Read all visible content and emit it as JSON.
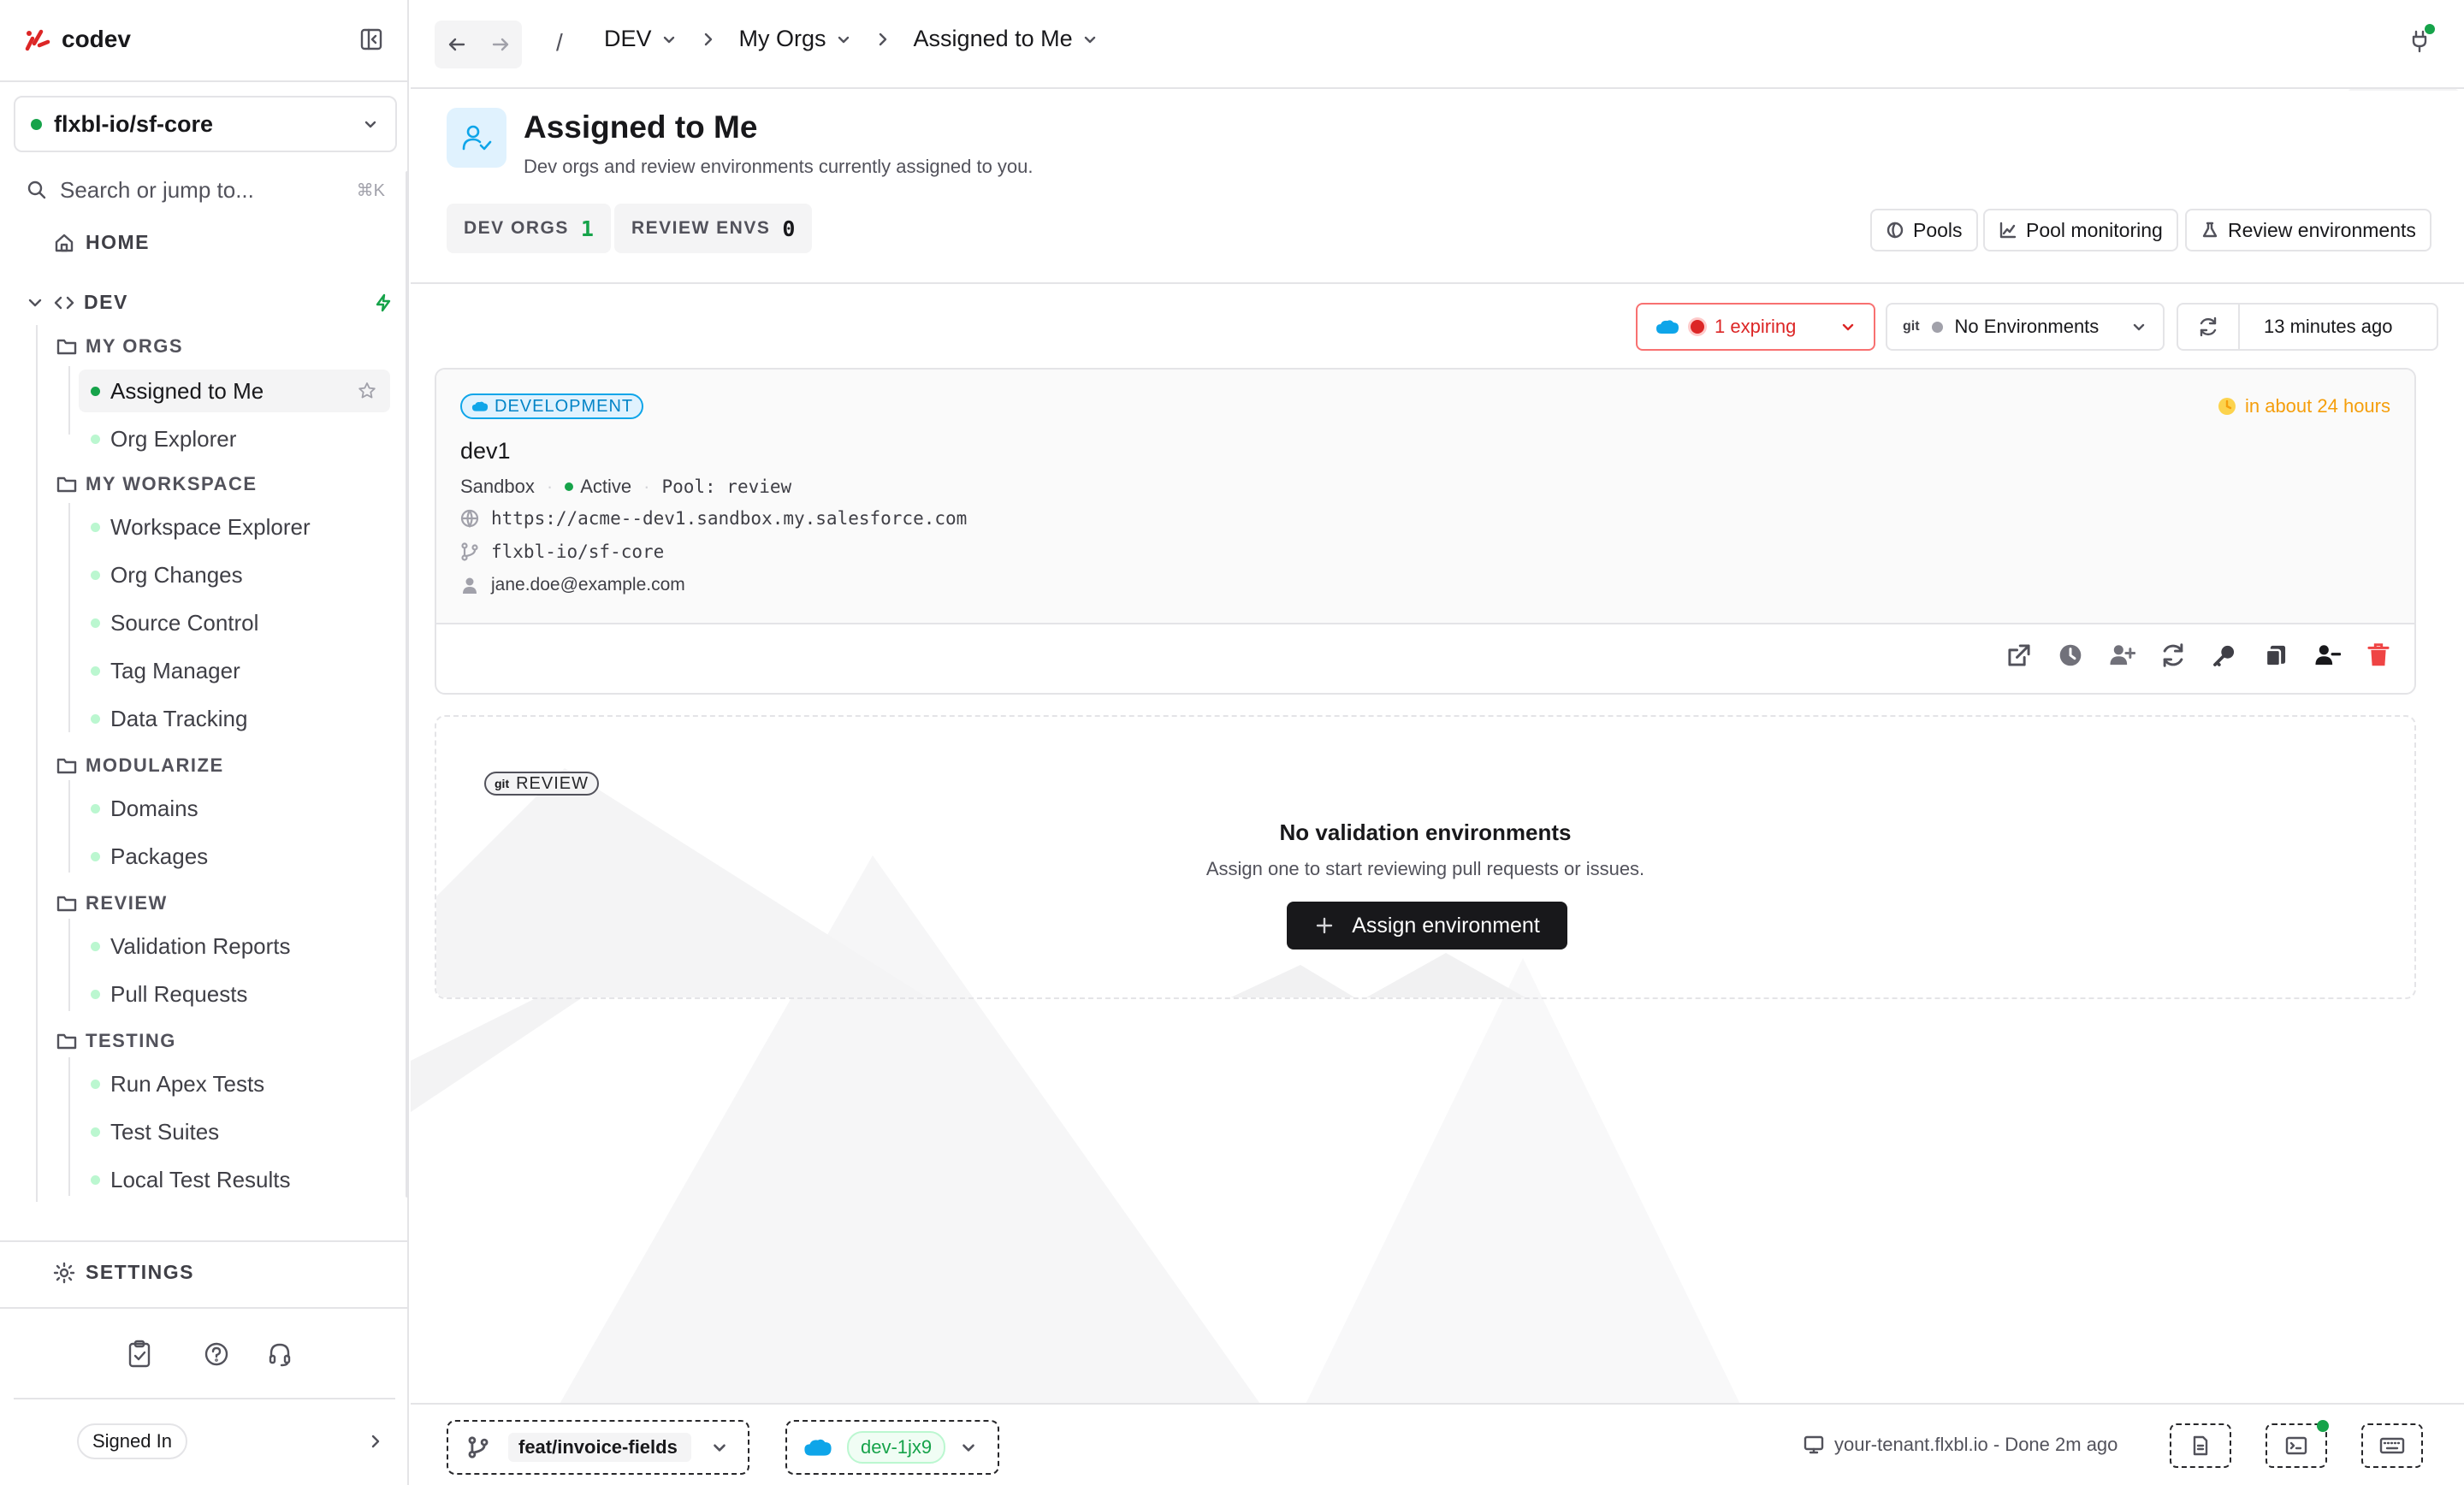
{
  "brand": {
    "name": "codev"
  },
  "repo_selector": {
    "value": "flxbl-io/sf-core"
  },
  "search": {
    "placeholder": "Search or jump to...",
    "shortcut": "⌘K"
  },
  "nav": {
    "home": "HOME",
    "dev": "DEV",
    "groups": [
      {
        "label": "MY ORGS",
        "items": [
          "Assigned to Me",
          "Org Explorer"
        ]
      },
      {
        "label": "MY WORKSPACE",
        "items": [
          "Workspace Explorer",
          "Org Changes",
          "Source Control",
          "Tag Manager",
          "Data Tracking"
        ]
      },
      {
        "label": "MODULARIZE",
        "items": [
          "Domains",
          "Packages"
        ]
      },
      {
        "label": "REVIEW",
        "items": [
          "Validation Reports",
          "Pull Requests"
        ]
      },
      {
        "label": "TESTING",
        "items": [
          "Run Apex Tests",
          "Test Suites",
          "Local Test Results"
        ]
      }
    ],
    "settings": "SETTINGS",
    "signed_in": "Signed In"
  },
  "breadcrumb": {
    "sep": "/",
    "items": [
      "DEV",
      "My Orgs",
      "Assigned to Me"
    ]
  },
  "page": {
    "title": "Assigned to Me",
    "subtitle": "Dev orgs and review environments currently assigned to you.",
    "stats": [
      {
        "label": "DEV ORGS",
        "value": "1"
      },
      {
        "label": "REVIEW ENVS",
        "value": "0"
      }
    ],
    "actions": [
      "Pools",
      "Pool monitoring",
      "Review environments"
    ]
  },
  "filters": {
    "expiring": "1 expiring",
    "git_tag": "git",
    "environments": "No Environments",
    "updated": "13 minutes ago"
  },
  "dev_card": {
    "badge": "DEVELOPMENT",
    "expiry": "in about 24 hours",
    "name": "dev1",
    "type": "Sandbox",
    "status": "Active",
    "pool": "Pool: review",
    "url": "https://acme--dev1.sandbox.my.salesforce.com",
    "repo": "flxbl-io/sf-core",
    "owner": "jane.doe@example.com"
  },
  "review_card": {
    "badge_git": "git",
    "badge": "REVIEW",
    "empty_title": "No validation environments",
    "empty_text": "Assign one to start reviewing pull requests or issues.",
    "button": "Assign environment"
  },
  "footer": {
    "branch": "feat/invoice-fields",
    "org": "dev-1jx9",
    "tenant": "your-tenant.flxbl.io - Done 2m ago"
  },
  "colors": {
    "accent_green": "#16a34a",
    "danger": "#dc2626",
    "warning": "#f59e0b",
    "salesforce_blue": "#0ea5e9"
  }
}
